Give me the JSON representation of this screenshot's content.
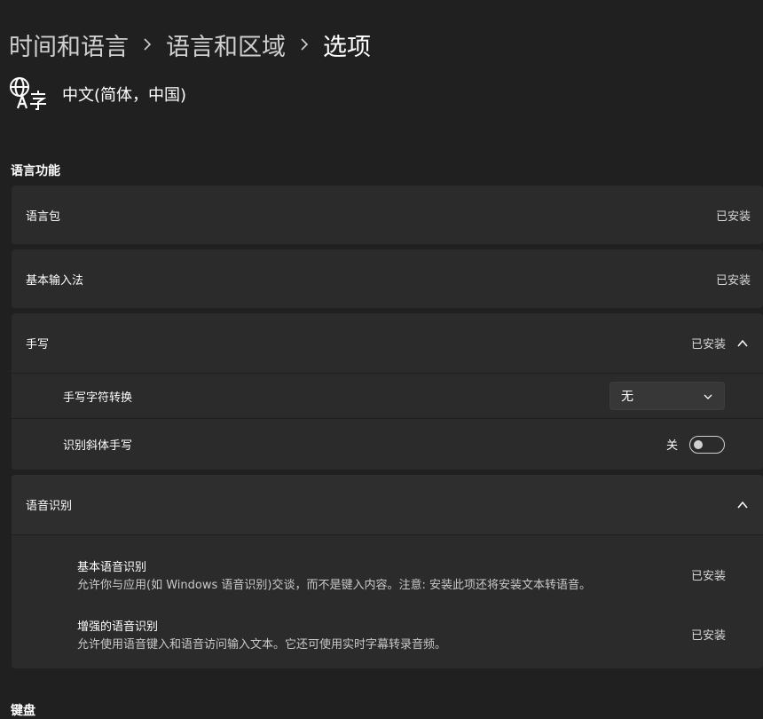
{
  "breadcrumb": {
    "items": [
      "时间和语言",
      "语言和区域",
      "选项"
    ]
  },
  "language": {
    "icon": "language-globe-icon",
    "name": "中文(简体，中国)"
  },
  "sections": {
    "language_features": {
      "title": "语言功能",
      "language_pack": {
        "label": "语言包",
        "status": "已安装"
      },
      "basic_typing": {
        "label": "基本输入法",
        "status": "已安装"
      },
      "handwriting": {
        "label": "手写",
        "status": "已安装",
        "expanded": true,
        "conversion": {
          "label": "手写字符转换",
          "selected": "无"
        },
        "italic": {
          "label": "识别斜体手写",
          "toggle_label": "关",
          "on": false
        }
      },
      "speech": {
        "label": "语音识别",
        "expanded": true,
        "basic": {
          "title": "基本语音识别",
          "desc": "允许你与应用(如 Windows 语音识别)交谈，而不是键入内容。注意: 安装此项还将安装文本转语音。",
          "status": "已安装"
        },
        "enhanced": {
          "title": "增强的语音识别",
          "desc": "允许使用语音键入和语音访问输入文本。它还可使用实时字幕转录音频。",
          "status": "已安装"
        }
      }
    },
    "keyboard": {
      "title": "键盘"
    }
  },
  "colors": {
    "background": "#202020",
    "card": "#2b2b2b",
    "text_primary": "#ffffff",
    "text_secondary": "#c9c9c9"
  }
}
